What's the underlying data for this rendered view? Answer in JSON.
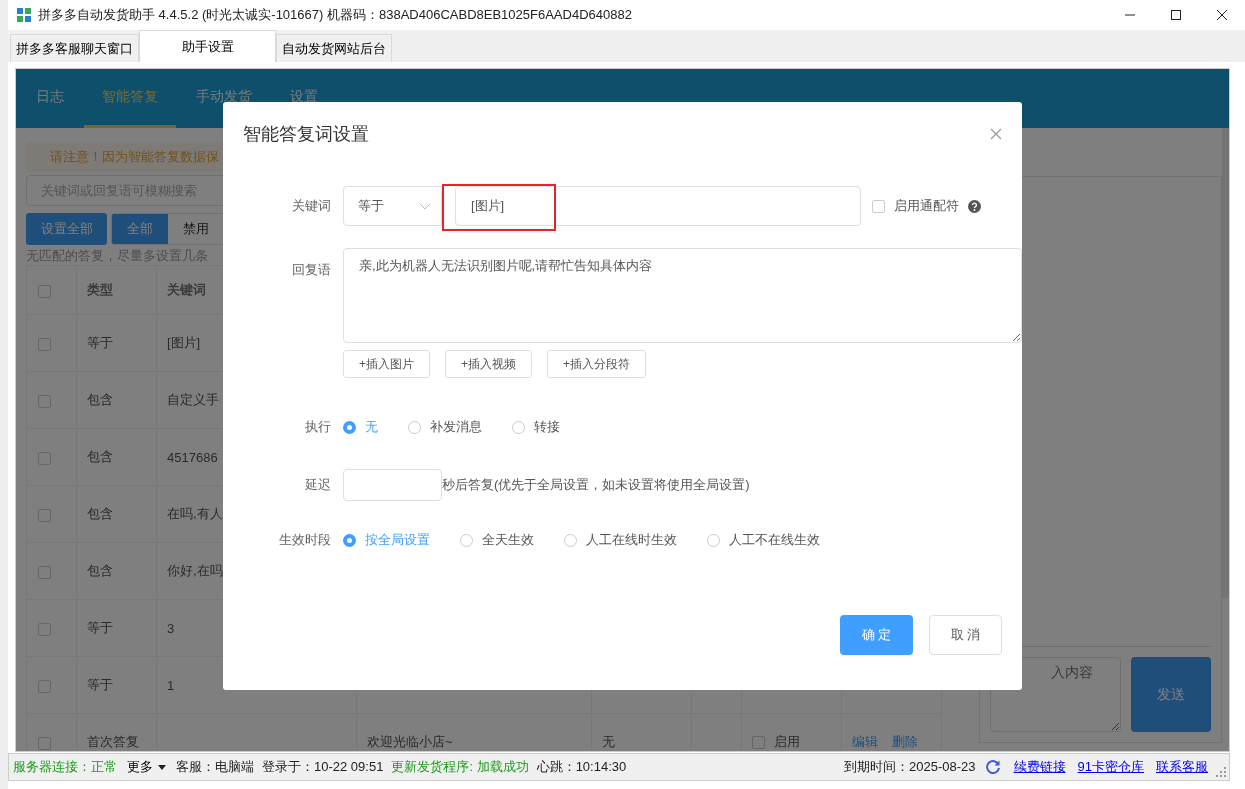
{
  "window": {
    "title": "拼多多自动发货助手 4.4.5.2 (时光太诚实-101667) 机器码：838AD406CABD8EB1025F6AAD4D640882"
  },
  "tabs": [
    {
      "label": "拼多多客服聊天窗口",
      "selected": false
    },
    {
      "label": "助手设置",
      "selected": true
    },
    {
      "label": "自动发货网站后台",
      "selected": false
    }
  ],
  "nav": [
    {
      "label": "日志",
      "selected": false
    },
    {
      "label": "智能答复",
      "selected": true
    },
    {
      "label": "手动发货",
      "selected": false
    },
    {
      "label": "设置",
      "selected": false
    }
  ],
  "notice": "请注意！因为智能答复数据保",
  "search": {
    "placeholder": "关键词或回复语可模糊搜索"
  },
  "set_all_button": "设置全部",
  "filters": [
    {
      "label": "全部",
      "selected": true
    },
    {
      "label": "禁用",
      "selected": false
    }
  ],
  "hint": "无匹配的答复，尽量多设置几条",
  "table": {
    "header_checked": false,
    "columns": [
      "类型",
      "关键词"
    ],
    "rows": [
      {
        "checked": false,
        "type": "等于",
        "keyword": "[图片]"
      },
      {
        "checked": false,
        "type": "包含",
        "keyword": "自定义手"
      },
      {
        "checked": false,
        "type": "包含",
        "keyword": "4517686"
      },
      {
        "checked": false,
        "type": "包含",
        "keyword": "在吗,有人"
      },
      {
        "checked": false,
        "type": "包含",
        "keyword": "你好,在吗"
      },
      {
        "checked": false,
        "type": "等于",
        "keyword": "3"
      },
      {
        "checked": false,
        "type": "等于",
        "keyword": "1"
      },
      {
        "checked": false,
        "type": "首次答复",
        "reply": "欢迎光临小店~",
        "action": "无",
        "enabled": {
          "label": "启用",
          "checked": false
        },
        "actions": [
          "编辑",
          "删除"
        ]
      }
    ]
  },
  "chat": {
    "placeholder": "入内容",
    "send": "发送"
  },
  "dialog": {
    "title": "智能答复词设置",
    "keyword_label": "关键词",
    "match": "等于",
    "keyword": "[图片]",
    "wildcard": {
      "label": "启用通配符",
      "checked": false
    },
    "reply_label": "回复语",
    "reply": "亲,此为机器人无法识别图片呢,请帮忙告知具体内容",
    "insert_buttons": [
      "+插入图片",
      "+插入视频",
      "+插入分段符"
    ],
    "action": {
      "label": "执行",
      "options": [
        {
          "label": "无",
          "selected": true
        },
        {
          "label": "补发消息",
          "selected": false
        },
        {
          "label": "转接",
          "selected": false
        }
      ]
    },
    "delay": {
      "label": "延迟",
      "suffix": "秒后答复(优先于全局设置，如未设置将使用全局设置)"
    },
    "period": {
      "label": "生效时段",
      "options": [
        {
          "label": "按全局设置",
          "selected": true
        },
        {
          "label": "全天生效",
          "selected": false
        },
        {
          "label": "人工在线时生效",
          "selected": false
        },
        {
          "label": "人工不在线生效",
          "selected": false
        }
      ]
    },
    "confirm": "确 定",
    "cancel": "取 消"
  },
  "status_bar": {
    "items": [
      {
        "kind": "ok",
        "text": "服务器连接：正常"
      },
      {
        "kind": "menu",
        "text": "更多"
      },
      {
        "kind": "plain",
        "text": "客服：电脑端"
      },
      {
        "kind": "plain",
        "text": "登录于：10-22 09:51"
      },
      {
        "kind": "ok",
        "text": "更新发货程序: 加载成功"
      },
      {
        "kind": "plain",
        "text": "心跳：10:14:30"
      }
    ],
    "expiry": "到期时间：2025-08-23",
    "links": [
      "续费链接",
      "91卡密仓库",
      "联系客服"
    ]
  }
}
